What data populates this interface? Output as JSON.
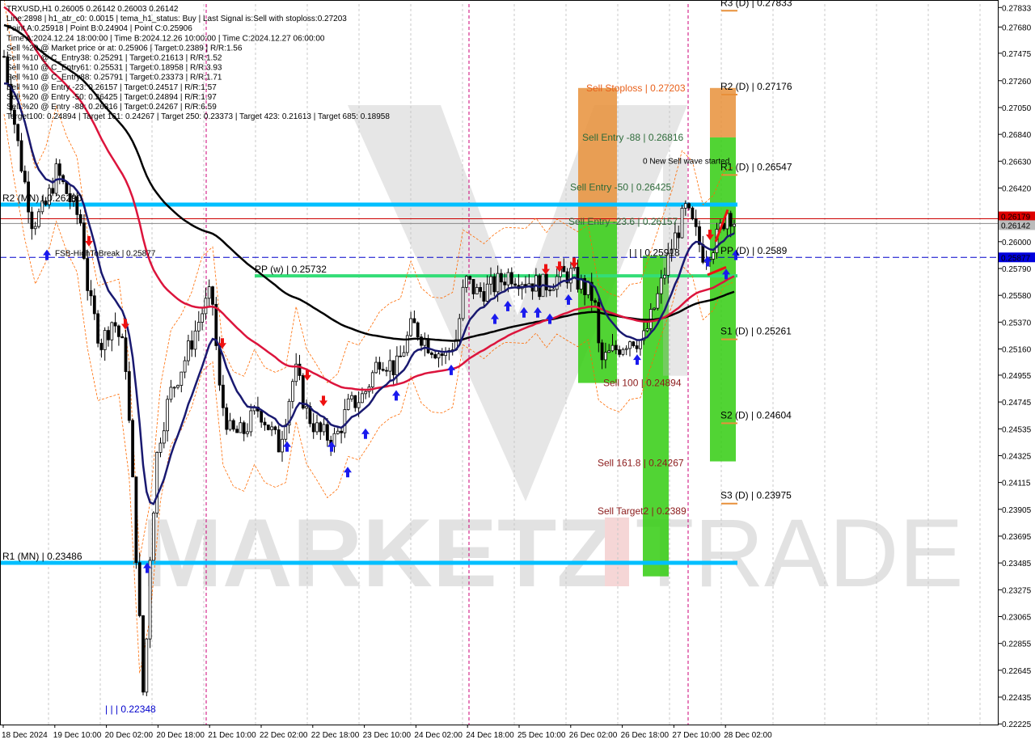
{
  "header": {
    "lines": [
      "TRXUSD,H1  0.26005 0.26142 0.26003 0.26142",
      "Line:2898 | h1_atr_c0: 0.0015 | tema_h1_status: Buy | Last Signal is:Sell with stoploss:0.27203",
      "Point A:0.25918 | Point B:0.24904 | Point C:0.25906",
      "Time A:2024.12.24 18:00:00 | Time B:2024.12.26 10:00:00 | Time C:2024.12.27 06:00:00",
      "Sell %20 @ Market price or at: 0.25906 | Target:0.2389 | R/R:1.56",
      "Sell %10 @ C_Entry38: 0.25291 | Target:0.21613 | R/R:1.52",
      "Sell %10 @ C_Entry61: 0.25531 | Target:0.18958 | R/R:3.93",
      "Sell %10 @ C_Entry88: 0.25791 | Target:0.23373 | R/R:1.71",
      "Sell %10 @ Entry -23: 0.26157 | Target:0.24517 | R/R:1.57",
      "Sell %20 @ Entry -50: 0.26425 | Target:0.24894 | R/R:1.97",
      "Sell %20 @ Entry -88: 0.26816 | Target:0.24267 | R/R:6.59",
      "Target100: 0.24894 | Target 161: 0.24267 | Target 250: 0.23373 | Target 423: 0.21613 | Target 685: 0.18958"
    ]
  },
  "chart_data": {
    "type": "candlestick",
    "symbol": "TRXUSD",
    "timeframe": "H1",
    "ylim": [
      0.2222,
      0.2786
    ],
    "y_ticks": [
      "0.27833",
      "0.27680",
      "0.27475",
      "0.27260",
      "0.27050",
      "0.26840",
      "0.26630",
      "0.26420",
      "0.26210",
      "0.26000",
      "0.25790",
      "0.25580",
      "0.25370",
      "0.25160",
      "0.24955",
      "0.24745",
      "0.24535",
      "0.24325",
      "0.24115",
      "0.23905",
      "0.23695",
      "0.23485",
      "0.23275",
      "0.23065",
      "0.22855",
      "0.22645",
      "0.22435",
      "0.22225"
    ],
    "x_ticks": [
      "18 Dec 2024",
      "19 Dec 10:00",
      "20 Dec 02:00",
      "20 Dec 18:00",
      "21 Dec 10:00",
      "22 Dec 02:00",
      "22 Dec 18:00",
      "23 Dec 10:00",
      "24 Dec 02:00",
      "24 Dec 18:00",
      "25 Dec 10:00",
      "26 Dec 02:00",
      "26 Dec 18:00",
      "27 Dec 10:00",
      "28 Dec 02:00"
    ],
    "current_price": "0.26142",
    "price_tags": [
      "0.26179",
      "0.26142",
      "0.25877"
    ],
    "levels": [
      {
        "label": "R3 (D) | 0.27833",
        "value": 0.27833
      },
      {
        "label": "R2 (D) | 0.27176",
        "value": 0.27176
      },
      {
        "label": "R1 (D) | 0.26547",
        "value": 0.26547
      },
      {
        "label": "PP (D) | 0.2589",
        "value": 0.2589
      },
      {
        "label": "S1 (D) | 0.25261",
        "value": 0.25261
      },
      {
        "label": "S2 (D) | 0.24604",
        "value": 0.24604
      },
      {
        "label": "S3 (D) | 0.23975",
        "value": 0.23975
      },
      {
        "label": "R2 (MN) | 0.26290",
        "value": 0.2629
      },
      {
        "label": "R1 (MN) | 0.23486",
        "value": 0.23486
      },
      {
        "label": "PP (w) | 0.25732",
        "value": 0.25732
      },
      {
        "label": "FSB-HighToBreak | 0.25877",
        "value": 0.25877
      }
    ],
    "sell_labels": [
      {
        "label": "Sell Stoploss | 0.27203",
        "value": 0.27203
      },
      {
        "label": "Sell Entry -88 | 0.26816",
        "value": 0.26816
      },
      {
        "label": "Sell Entry -50 | 0.26425",
        "value": 0.26425
      },
      {
        "label": "Sell Entry -23.6 | 0.26157",
        "value": 0.26157
      },
      {
        "label": "Sell 100 | 0.24894",
        "value": 0.24894
      },
      {
        "label": "Sell 161.8 | 0.24267",
        "value": 0.24267
      },
      {
        "label": "Sell Target2 | 0.2389",
        "value": 0.2389
      }
    ],
    "annotations": [
      "0 New Sell wave started",
      "| | | 0.25918",
      "| | | 0.22348"
    ],
    "series": [
      {
        "name": "EMA black",
        "color": "#000000"
      },
      {
        "name": "EMA red",
        "color": "#dc143c"
      },
      {
        "name": "EMA navy",
        "color": "#191970"
      }
    ],
    "watermark": "MARKETZITRADE"
  },
  "colors": {
    "up_candle": "#ffffff",
    "down_candle": "#000000",
    "cyan_level": "#00bfff",
    "green_level": "#33dd77",
    "stoploss_orange": "#e8903a",
    "target_green": "#33cc11",
    "buy_arrow": "#1a1aee",
    "sell_arrow": "#ee1111",
    "vline_magenta": "#cc0077"
  }
}
